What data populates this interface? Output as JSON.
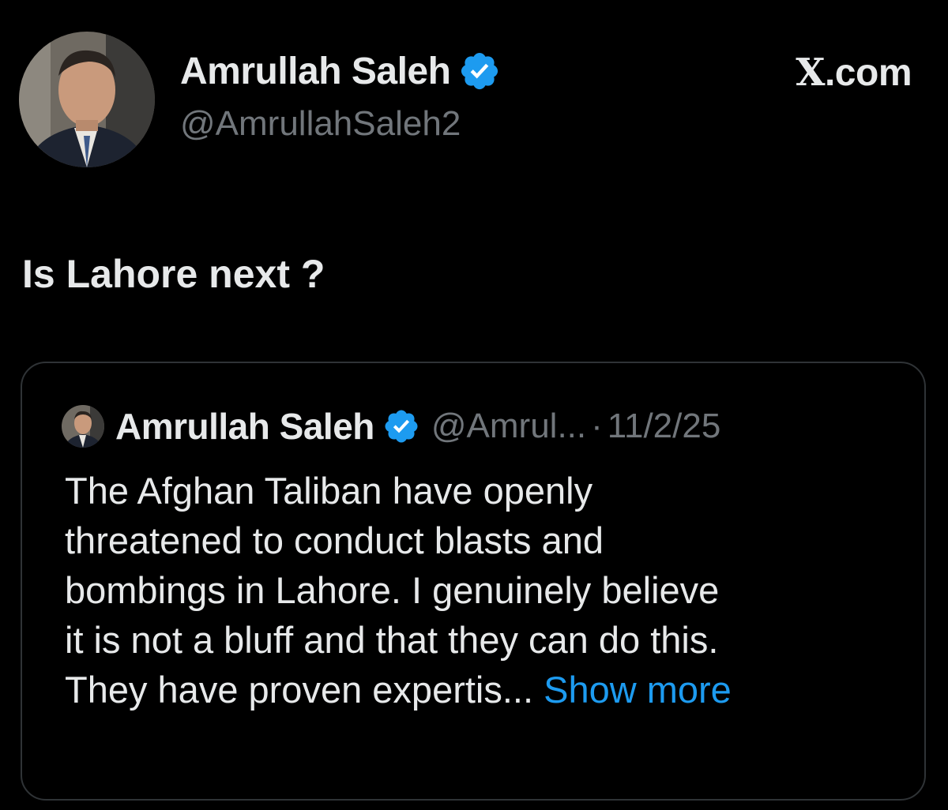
{
  "author": {
    "display_name": "Amrullah Saleh",
    "handle": "@AmrullahSaleh2",
    "verified_icon": "verified-badge-icon"
  },
  "site_label": {
    "mark": "X",
    "suffix": ".com"
  },
  "tweet": {
    "text": "Is Lahore next ?"
  },
  "quoted_tweet": {
    "display_name": "Amrullah Saleh",
    "handle": "@Amrul...",
    "separator": "·",
    "date": "11/2/25",
    "lines": [
      "The Afghan Taliban have openly",
      "threatened to conduct blasts and",
      "bombings in Lahore. I genuinely believe",
      "it is not a bluff and that they can do this.",
      "They have proven expertis..."
    ],
    "show_more": "Show more"
  },
  "colors": {
    "background": "#000000",
    "text_primary": "#e7e9ea",
    "text_secondary": "#71767b",
    "link": "#1d9bf0",
    "verified": "#1d9bf0",
    "border": "#2f3336"
  }
}
